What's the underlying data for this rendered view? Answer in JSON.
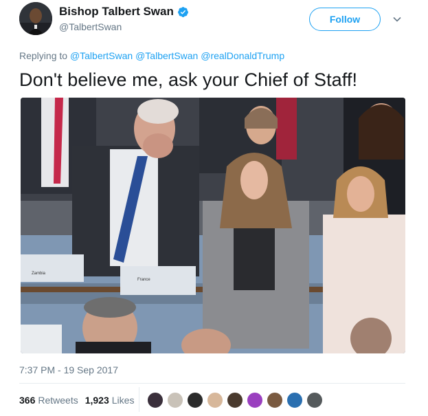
{
  "author": {
    "display_name": "Bishop Talbert Swan",
    "handle": "@TalbertSwan",
    "verified": true
  },
  "follow_label": "Follow",
  "reply": {
    "prefix": "Replying to",
    "mentions": [
      "@TalbertSwan",
      "@TalbertSwan",
      "@realDonaldTrump"
    ]
  },
  "tweet_text": "Don't believe me, ask your Chief of Staff!",
  "media": {
    "placards": [
      "Zambia",
      "France"
    ]
  },
  "timestamp": "7:37 PM - 19 Sep 2017",
  "stats": {
    "retweets_count": "366",
    "retweets_label": "Retweets",
    "likes_count": "1,923",
    "likes_label": "Likes"
  },
  "likers": [
    {
      "color": "#3a2f3b"
    },
    {
      "color": "#c9c2b8"
    },
    {
      "color": "#2b2b2b"
    },
    {
      "color": "#d7b79a"
    },
    {
      "color": "#4a3a2e"
    },
    {
      "color": "#9a3fbf"
    },
    {
      "color": "#7a5a40"
    },
    {
      "color": "#2a6fb0"
    },
    {
      "color": "#555a5c"
    }
  ],
  "colors": {
    "accent": "#1da1f2",
    "text": "#14171a",
    "muted": "#657786"
  }
}
